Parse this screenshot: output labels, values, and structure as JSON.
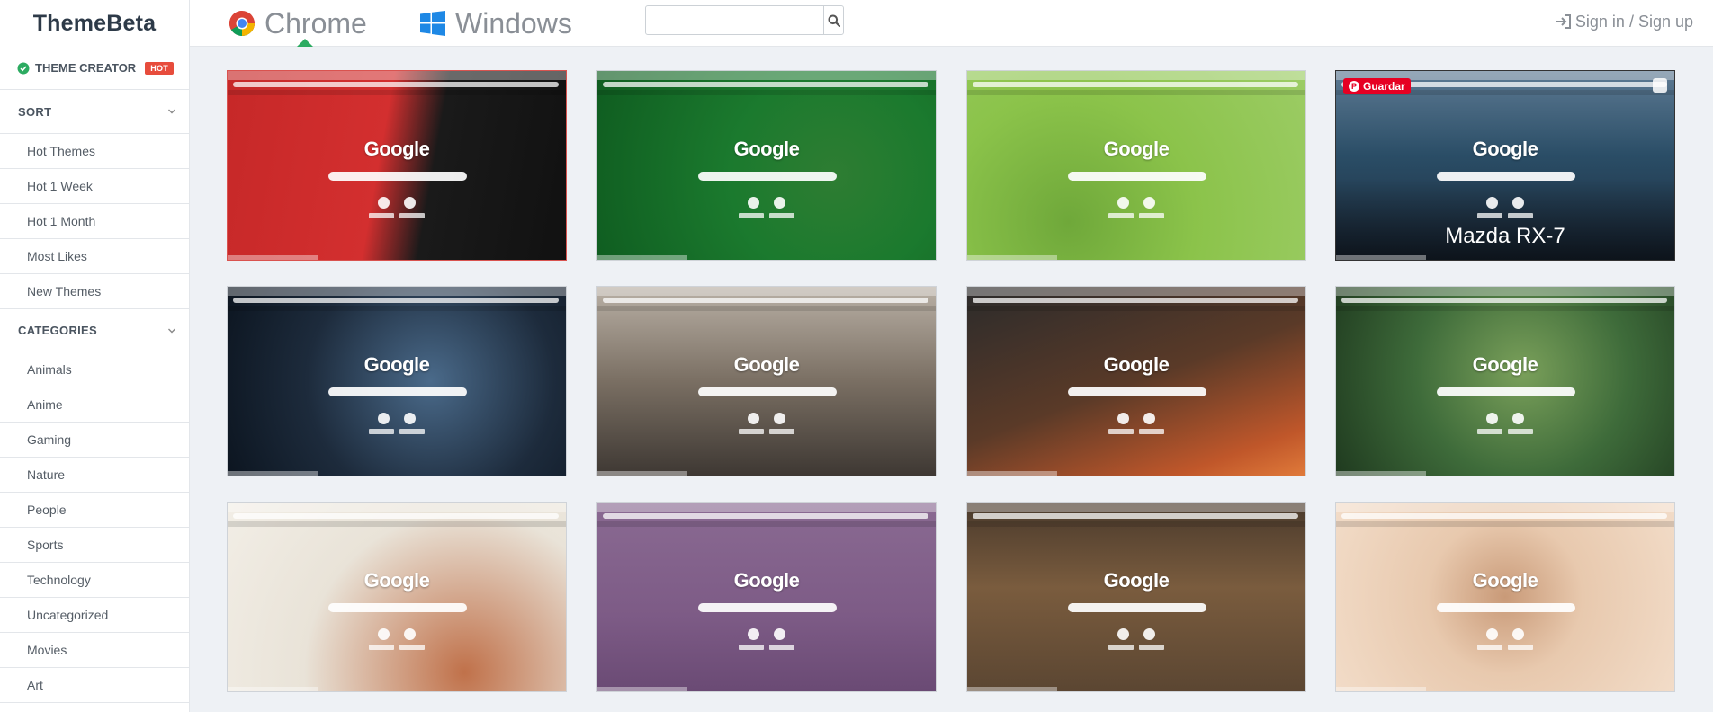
{
  "brand": "ThemeBeta",
  "nav": {
    "chrome": "Chrome",
    "windows": "Windows",
    "active": "Chrome"
  },
  "search": {
    "placeholder": "",
    "value": ""
  },
  "signin": "Sign in / Sign up",
  "sidebar": {
    "creator": "THEME CREATOR",
    "hot_badge": "HOT",
    "sort": {
      "title": "SORT",
      "items": [
        "Hot Themes",
        "Hot 1 Week",
        "Hot 1 Month",
        "Most Likes",
        "New Themes"
      ]
    },
    "categories": {
      "title": "CATEGORIES",
      "items": [
        "Animals",
        "Anime",
        "Gaming",
        "Nature",
        "People",
        "Sports",
        "Technology",
        "Uncategorized",
        "Movies",
        "Art"
      ]
    }
  },
  "themes": [
    {
      "logo": "Google",
      "caption": "",
      "accent": "#c62828"
    },
    {
      "logo": "Google",
      "caption": "",
      "accent": "#1b7a2e"
    },
    {
      "logo": "Google",
      "caption": "",
      "accent": "#8bc34a"
    },
    {
      "logo": "Google",
      "caption": "Mazda RX-7",
      "accent": "#2a4d66",
      "pin_label": "Guardar"
    },
    {
      "logo": "Google",
      "caption": "",
      "accent": "#1d2b3c"
    },
    {
      "logo": "Google",
      "caption": "",
      "accent": "#6b625a"
    },
    {
      "logo": "Google",
      "caption": "",
      "accent": "#5a3a28"
    },
    {
      "logo": "Google",
      "caption": "",
      "accent": "#3e6b3a"
    },
    {
      "logo": "Google",
      "caption": "",
      "accent": "#e9e3d8"
    },
    {
      "logo": "Google",
      "caption": "",
      "accent": "#7d5b86"
    },
    {
      "logo": "Google",
      "caption": "",
      "accent": "#5b4632"
    },
    {
      "logo": "Google",
      "caption": "",
      "accent": "#e8c9ae"
    }
  ],
  "colors": {
    "accent_green": "#2cab61",
    "hot_red": "#e74c3c",
    "pinterest_red": "#e60023"
  }
}
